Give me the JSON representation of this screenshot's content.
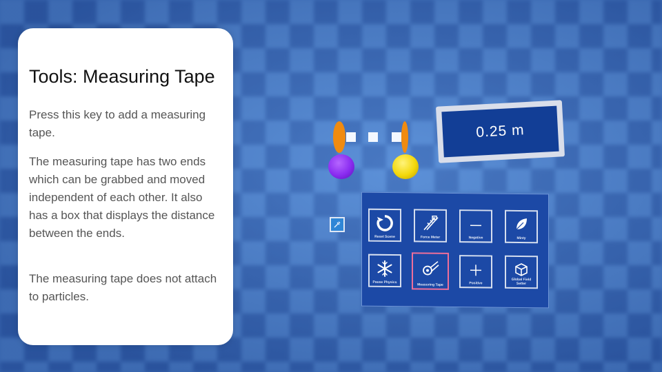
{
  "card": {
    "title": "Tools: Measuring Tape",
    "paragraphs": [
      "Press this key to add a measuring tape.",
      "The measuring tape has two ends which can be grabbed and moved independent of each other. It also has a box that displays the distance between the ends.",
      "The measuring tape does not attach to particles."
    ]
  },
  "tape": {
    "readout": "0.25 m",
    "end_a_color": "#8a2cf0",
    "end_b_color": "#f3d80a",
    "handle_color": "#f08b10"
  },
  "toolbar": {
    "selected_color": "#ef6f9a",
    "tools": [
      {
        "label": "Reset Scene",
        "icon": "reset-icon"
      },
      {
        "label": "Force Meter",
        "icon": "force-meter-icon"
      },
      {
        "label": "Negative",
        "icon": "minus-icon"
      },
      {
        "label": "Minty",
        "icon": "leaf-icon"
      },
      {
        "label": "Pause Physics",
        "icon": "snowflake-icon"
      },
      {
        "label": "Measuring Tape",
        "icon": "measuring-tape-icon"
      },
      {
        "label": "Positive",
        "icon": "plus-icon"
      },
      {
        "label": "Global Field Setter",
        "icon": "cube-icon"
      }
    ]
  }
}
